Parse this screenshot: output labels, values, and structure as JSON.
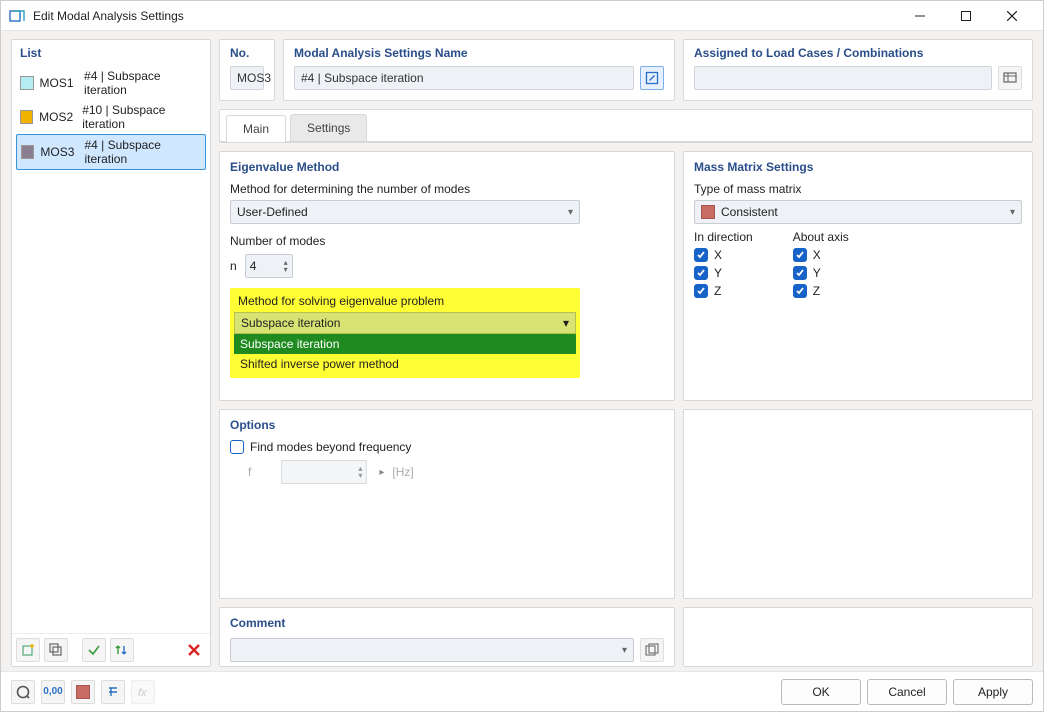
{
  "window": {
    "title": "Edit Modal Analysis Settings"
  },
  "left": {
    "title": "List",
    "items": [
      {
        "id": "MOS1",
        "label": "#4 | Subspace iteration",
        "swatch": "#b4ecf1"
      },
      {
        "id": "MOS2",
        "label": "#10 | Subspace iteration",
        "swatch": "#f0b400"
      },
      {
        "id": "MOS3",
        "label": "#4 | Subspace iteration",
        "swatch": "#8b7e8e"
      }
    ]
  },
  "no": {
    "label": "No.",
    "value": "MOS3"
  },
  "name": {
    "label": "Modal Analysis Settings Name",
    "value": "#4 | Subspace iteration"
  },
  "assigned": {
    "label": "Assigned to Load Cases / Combinations",
    "value": ""
  },
  "tabs": {
    "main": "Main",
    "settings": "Settings"
  },
  "eigen": {
    "title": "Eigenvalue Method",
    "method_label": "Method for determining the number of modes",
    "method_value": "User-Defined",
    "n_label": "Number of modes",
    "n_sym": "n",
    "n_value": "4",
    "solve_label": "Method for solving eigenvalue problem",
    "solve_value": "Subspace iteration",
    "solve_options": [
      "Subspace iteration",
      "Shifted inverse power method"
    ]
  },
  "options": {
    "title": "Options",
    "find_label": "Find modes beyond frequency",
    "f_sym": "f",
    "f_unit": "[Hz]"
  },
  "mass": {
    "title": "Mass Matrix Settings",
    "type_label": "Type of mass matrix",
    "type_value": "Consistent",
    "dir_label": "In direction",
    "axis_label": "About axis",
    "x": "X",
    "y": "Y",
    "z": "Z"
  },
  "comment": {
    "title": "Comment",
    "value": ""
  },
  "footer": {
    "ok": "OK",
    "cancel": "Cancel",
    "apply": "Apply"
  }
}
